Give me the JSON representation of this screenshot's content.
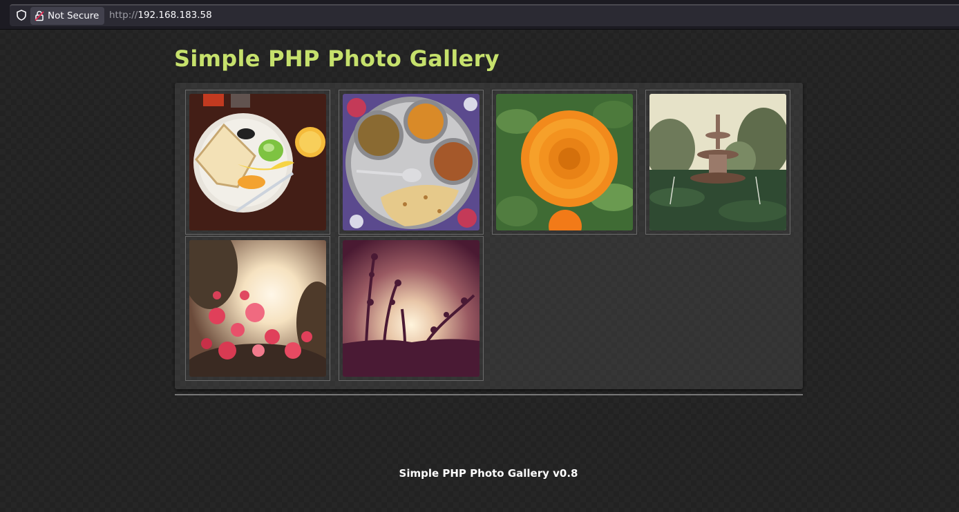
{
  "browser": {
    "security_label": "Not Secure",
    "url_scheme": "http://",
    "url_host": "192.168.183.58"
  },
  "page": {
    "title": "Simple PHP Photo Gallery",
    "footer": "Simple PHP Photo Gallery v0.8"
  },
  "gallery": {
    "photos": [
      {
        "subject": "breakfast plate with bread, banana, lime and juice"
      },
      {
        "subject": "thali plate with curries and flatbread"
      },
      {
        "subject": "orange marigold flower"
      },
      {
        "subject": "garden fountain"
      },
      {
        "subject": "pink bougainvillea at sunset"
      },
      {
        "subject": "silhouetted plant at sunset"
      }
    ]
  },
  "colors": {
    "title": "#c6e16c",
    "background": "#222222",
    "panel": "#333333"
  }
}
